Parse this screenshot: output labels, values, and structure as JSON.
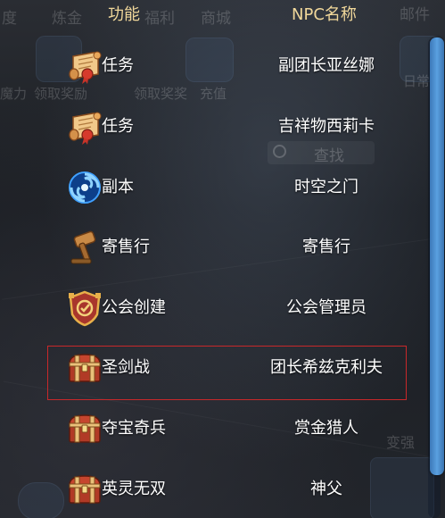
{
  "header": {
    "function_label": "功能",
    "npc_label": "NPC名称"
  },
  "background": {
    "top_tabs": [
      "度",
      "炼金",
      "福利",
      "商城",
      "邮件"
    ],
    "labels": [
      "魔力",
      "领取奖励",
      "领取奖奖",
      "充值",
      "日常",
      "变强"
    ],
    "search_text": "查找"
  },
  "rows": [
    {
      "icon": "scroll-quest-icon",
      "function": "任务",
      "npc": "副团长亚丝娜"
    },
    {
      "icon": "scroll-quest-icon",
      "function": "任务",
      "npc": "吉祥物西莉卡"
    },
    {
      "icon": "portal-icon",
      "function": "副本",
      "npc": "时空之门"
    },
    {
      "icon": "hammer-icon",
      "function": "寄售行",
      "npc": "寄售行"
    },
    {
      "icon": "guild-crest-icon",
      "function": "公会创建",
      "npc": "公会管理员"
    },
    {
      "icon": "treasure-chest-icon",
      "function": "圣剑战",
      "npc": "团长希兹克利夫"
    },
    {
      "icon": "treasure-chest-icon",
      "function": "夺宝奇兵",
      "npc": "赏金猎人"
    },
    {
      "icon": "treasure-chest-icon",
      "function": "英灵无双",
      "npc": "神父"
    }
  ],
  "highlighted_row_index": 5,
  "colors": {
    "header_text": "#f0d79a",
    "highlight_border": "#c8282a",
    "scrollbar": "#4a8cd0"
  }
}
